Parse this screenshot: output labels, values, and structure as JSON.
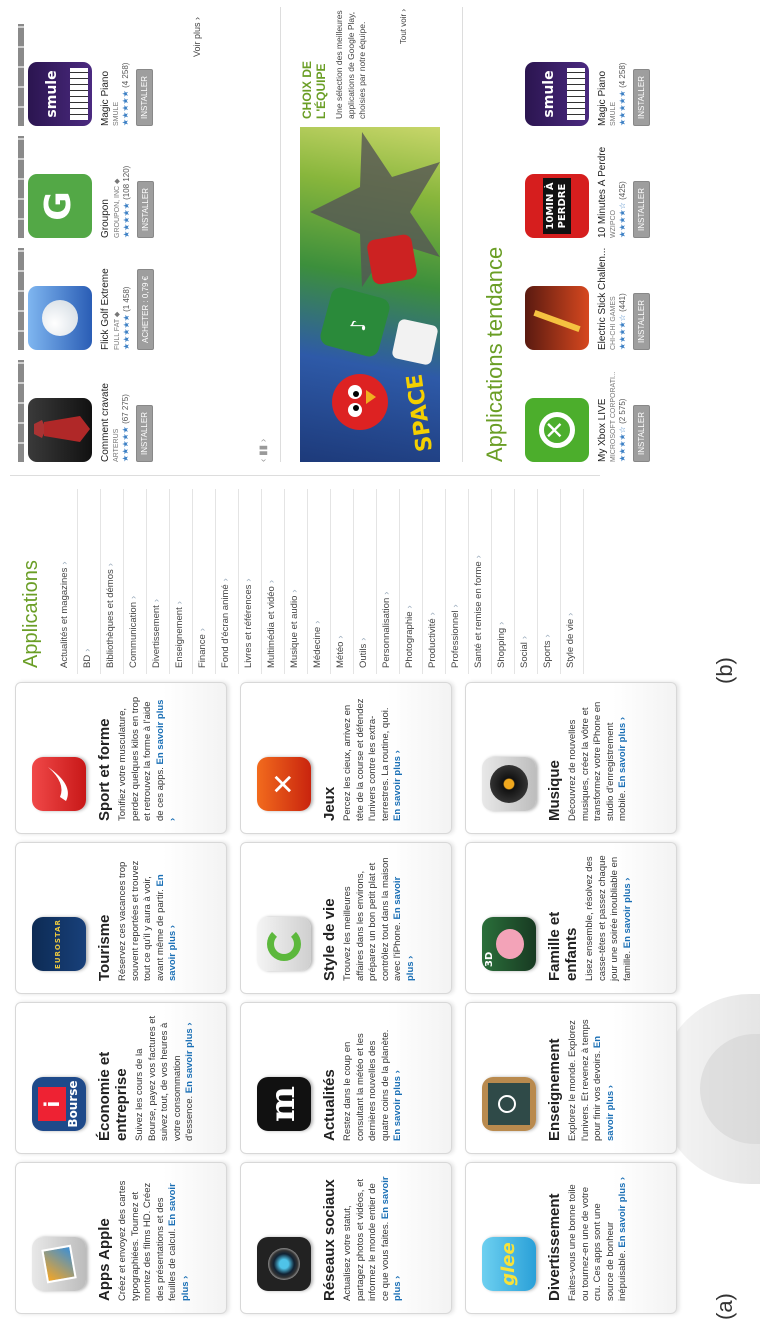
{
  "labels": {
    "a": "(a)",
    "b": "(b)"
  },
  "categories_a": [
    {
      "title": "Apps Apple",
      "desc": "Créez et envoyez des cartes typographiées. Tournez et montez des films HD. Créez des présentations et des feuilles de calcul.",
      "more": "En savoir plus ›",
      "icon": "photo-app-icon"
    },
    {
      "title": "Économie et entreprise",
      "desc": "Suivez les cours de la Bourse, payez vos factures et suivez tout, de vos heures à votre consommation d'essence.",
      "more": "En savoir plus ›",
      "icon": "bourse-icon",
      "icon_text": "Bourse"
    },
    {
      "title": "Tourisme",
      "desc": "Réservez ces vacances trop souvent reportées et trouvez tout ce qu'il y aura à voir, avant même de partir.",
      "more": "En savoir plus ›",
      "icon": "eurostar-icon",
      "icon_text": "EUROSTAR"
    },
    {
      "title": "Sport et forme",
      "desc": "Tonifiez votre musculature, perdez quelques kilos en trop et retrouvez la forme à l'aide de ces apps.",
      "more": "En savoir plus ›",
      "icon": "nike-icon"
    },
    {
      "title": "Réseaux sociaux",
      "desc": "Actualisez votre statut, partagez photos et vidéos, et informez le monde entier de ce que vous faites.",
      "more": "En savoir plus ›",
      "icon": "camera-lens-icon"
    },
    {
      "title": "Actualités",
      "desc": "Restez dans le coup en consultant la météo et les dernières nouvelles des quatre coins de la planète.",
      "more": "En savoir plus ›",
      "icon": "le-monde-icon",
      "icon_text": "m"
    },
    {
      "title": "Style de vie",
      "desc": "Trouvez les meilleures affaires dans les environs, préparez un bon petit plat et contrôlez tout dans la maison avec l'iPhone.",
      "more": "En savoir plus ›",
      "icon": "groupon-g-icon"
    },
    {
      "title": "Jeux",
      "desc": "Percez les cieux, arrivez en tête de la course et défendez l'univers contre les extra-terrestres. La routine, quoi.",
      "more": "En savoir plus ›",
      "icon": "game-swords-icon"
    },
    {
      "title": "Divertissement",
      "desc": "Faites-vous une bonne toile ou tournez-en une de votre cru. Ces apps sont une source de bonheur inépuisable.",
      "more": "En savoir plus ›",
      "icon": "smule-glee-icon",
      "icon_text": "glee"
    },
    {
      "title": "Enseignement",
      "desc": "Explorez le monde. Explorez l'univers. Et revenez à temps pour finir vos devoirs.",
      "more": "En savoir plus ›",
      "icon": "chalkboard-icon"
    },
    {
      "title": "Famille et enfants",
      "desc": "Lisez ensemble, résolvez des casse-têtes et passez chaque jour une soirée inoubliable en famille.",
      "more": "En savoir plus ›",
      "icon": "three-little-pigs-icon",
      "icon_text": "3D"
    },
    {
      "title": "Musique",
      "desc": "Découvrez de nouvelles musiques, créez la vôtre et transformez votre iPhone en studio d'enregistrement mobile.",
      "more": "En savoir plus ›",
      "icon": "turntable-icon"
    }
  ],
  "sidebar": {
    "title": "Applications",
    "items": [
      "Actualités et magazines",
      "BD",
      "Bibliothèques et démos",
      "Communication",
      "Divertissement",
      "Enseignement",
      "Finance",
      "Fond d'écran animé",
      "Livres et références",
      "Multimédia et vidéo",
      "Musique et audio",
      "Médecine",
      "Météo",
      "Outils",
      "Personnalisation",
      "Photographie",
      "Productivité",
      "Professionnel",
      "Santé et remise en forme",
      "Shopping",
      "Social",
      "Sports",
      "Style de vie"
    ]
  },
  "top_apps": [
    {
      "name": "Comment cravate",
      "dev": "ARTERUS",
      "stars": "★★★★★",
      "count": "(67 275)",
      "button": "INSTALLER",
      "icon": "tie-icon"
    },
    {
      "name": "Flick Golf Extreme",
      "dev": "FULL FAT ◆",
      "stars": "★★★★★",
      "count": "(1 458)",
      "button": "ACHETER : 0,79 €",
      "icon": "golf-ball-icon"
    },
    {
      "name": "Groupon",
      "dev": "GROUPON, INC ◆",
      "stars": "★★★★★",
      "count": "(108 120)",
      "button": "INSTALLER",
      "icon": "groupon-icon"
    },
    {
      "name": "Magic Piano",
      "dev": "SMULE",
      "stars": "★★★★★",
      "count": "(4 258)",
      "button": "INSTALLER",
      "icon": "smule-piano-icon",
      "icon_text": "smule"
    }
  ],
  "trend_apps": [
    {
      "name": "My Xbox LIVE",
      "dev": "MICROSOFT CORPORATI...",
      "stars": "★★★★☆",
      "count": "(2 575)",
      "button": "INSTALLER",
      "icon": "xbox-icon"
    },
    {
      "name": "Electric Stick Challen...",
      "dev": "CHI-CHI GAMES",
      "stars": "★★★★☆",
      "count": "(441)",
      "button": "INSTALLER",
      "icon": "stick-fight-icon"
    },
    {
      "name": "10 Minutes À Perdre",
      "dev": "WZIPCO",
      "stars": "★★★★☆",
      "count": "(425)",
      "button": "INSTALLER",
      "icon": "ten-minutes-icon",
      "icon_text": "10MIN À PERDRE"
    },
    {
      "name": "Magic Piano",
      "dev": "SMULE",
      "stars": "★★★★★",
      "count": "(4 258)",
      "button": "INSTALLER",
      "icon": "smule-piano-icon",
      "icon_text": "smule"
    }
  ],
  "voir_plus": "Voir plus ›",
  "tout_voir": "Tout voir ›",
  "choix": {
    "title": "CHOIX DE L'ÉQUIPE",
    "desc": "Une sélection des meilleures applications de Google Play, choisies par notre équipe."
  },
  "banner_text": "SPACE",
  "trend_title": "Applications tendance",
  "colors": {
    "accent_green": "#6a9e25",
    "link_blue": "#1a6fb5"
  }
}
